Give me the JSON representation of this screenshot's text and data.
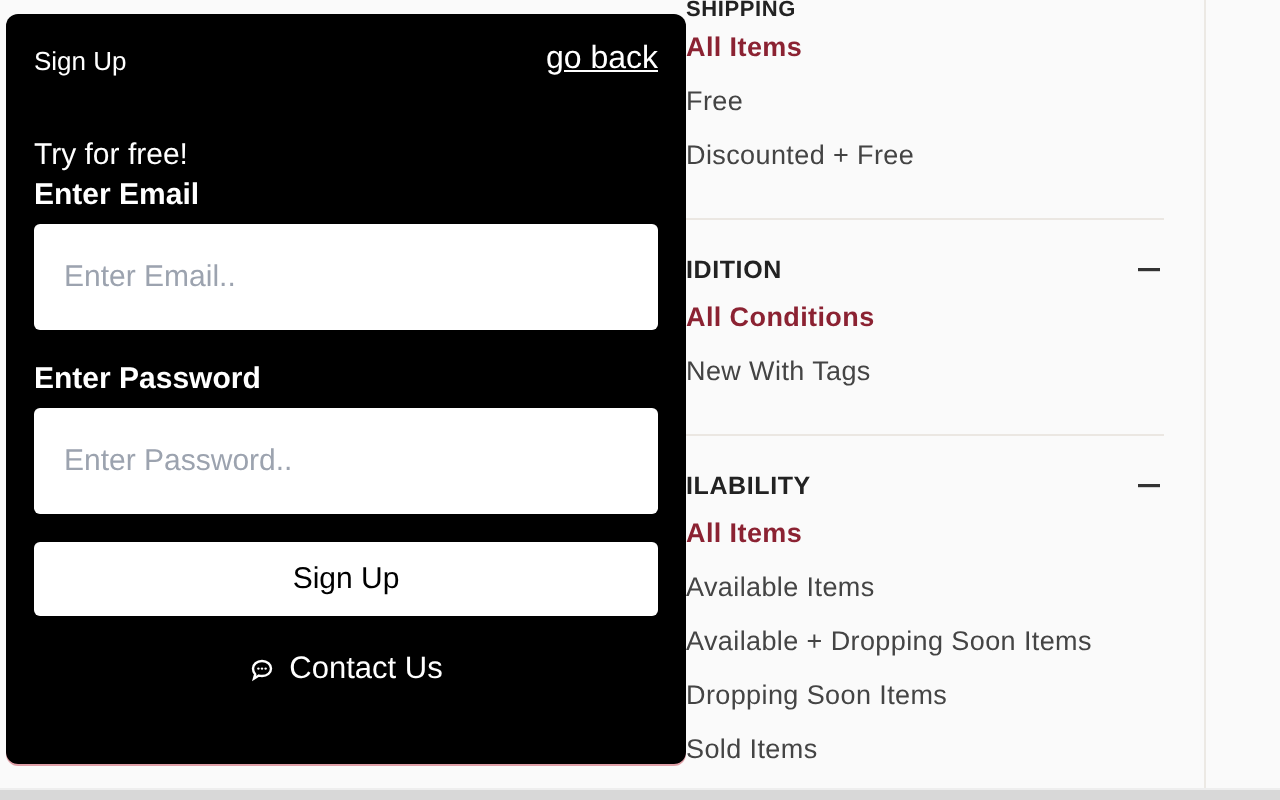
{
  "filters": [
    {
      "heading": "SHIPPING",
      "options": [
        {
          "label": "All Items",
          "selected": true
        },
        {
          "label": "Free",
          "selected": false
        },
        {
          "label": "Discounted + Free",
          "selected": false
        }
      ]
    },
    {
      "heading": "IDITION",
      "options": [
        {
          "label": "All Conditions",
          "selected": true
        },
        {
          "label": "New With Tags",
          "selected": false
        }
      ]
    },
    {
      "heading": "ILABILITY",
      "options": [
        {
          "label": "All Items",
          "selected": true
        },
        {
          "label": "Available Items",
          "selected": false
        },
        {
          "label": "Available + Dropping Soon Items",
          "selected": false
        },
        {
          "label": "Dropping Soon Items",
          "selected": false
        },
        {
          "label": "Sold Items",
          "selected": false
        }
      ]
    }
  ],
  "modal": {
    "title": "Sign Up",
    "back_link": "go back",
    "tagline": "Try for free!",
    "email_label": "Enter Email",
    "email_placeholder": "Enter Email..",
    "password_label": "Enter Password",
    "password_placeholder": "Enter Password..",
    "submit": "Sign Up",
    "contact": "Contact Us"
  }
}
